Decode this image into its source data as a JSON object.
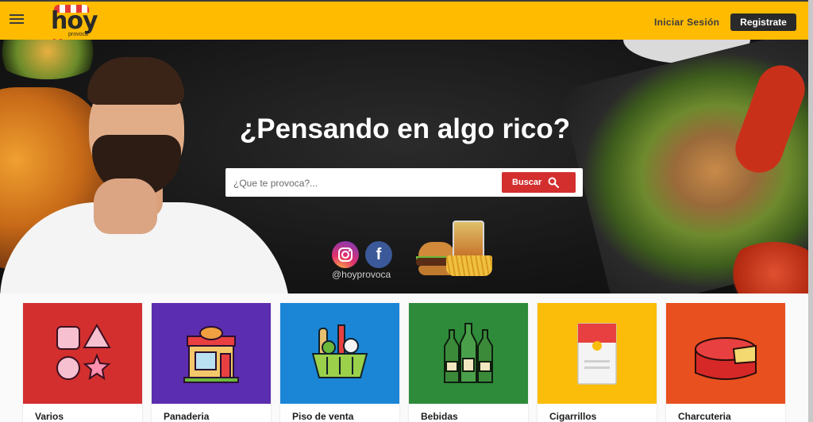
{
  "header": {
    "logo_text": "hoy",
    "logo_subtext": "provoca",
    "login_label": "Iniciar Sesión",
    "register_label": "Registrate"
  },
  "hero": {
    "title": "¿Pensando en algo rico?",
    "search_placeholder": "¿Que te provoca?...",
    "search_button": "Buscar",
    "social_handle": "@hoyprovoca"
  },
  "categories": [
    {
      "label": "Varios",
      "color": "#d32f2f",
      "icon": "shapes-icon"
    },
    {
      "label": "Panaderia",
      "color": "#5b2db0",
      "icon": "bakery-icon"
    },
    {
      "label": "Piso de venta",
      "color": "#1b86d6",
      "icon": "grocery-basket-icon"
    },
    {
      "label": "Bebidas",
      "color": "#2e8b3a",
      "icon": "bottles-icon"
    },
    {
      "label": "Cigarrillos",
      "color": "#fbbc0a",
      "icon": "cigarette-pack-icon"
    },
    {
      "label": "Charcuteria",
      "color": "#e8501f",
      "icon": "cheese-icon"
    }
  ],
  "colors": {
    "topbar": "#ffbb00",
    "dark": "#2a2a2a",
    "accent_red": "#d32f2f"
  }
}
